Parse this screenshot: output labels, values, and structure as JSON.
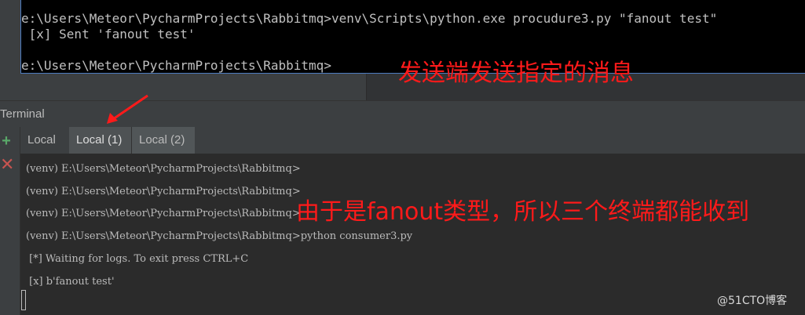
{
  "cmd_window": {
    "lines": [
      "e:\\Users\\Meteor\\PycharmProjects\\Rabbitmq>venv\\Scripts\\python.exe procudure3.py \"fanout test\"",
      " [x] Sent 'fanout test'",
      "",
      "e:\\Users\\Meteor\\PycharmProjects\\Rabbitmq>"
    ]
  },
  "terminal": {
    "title": "Terminal",
    "tabs": [
      {
        "label": "Local"
      },
      {
        "label": "Local (1)"
      },
      {
        "label": "Local (2)"
      }
    ],
    "lines": [
      "(venv) E:\\Users\\Meteor\\PycharmProjects\\Rabbitmq>",
      "(venv) E:\\Users\\Meteor\\PycharmProjects\\Rabbitmq>",
      "(venv) E:\\Users\\Meteor\\PycharmProjects\\Rabbitmq>",
      "(venv) E:\\Users\\Meteor\\PycharmProjects\\Rabbitmq>python consumer3.py",
      " [*] Waiting for logs. To exit press CTRL+C",
      " [x] b'fanout test'"
    ],
    "icons": {
      "add": "plus-icon",
      "close": "close-icon"
    }
  },
  "annotations": {
    "sender_note": "发送端发送指定的消息",
    "fanout_note": "由于是fanout类型，所以三个终端都能收到"
  },
  "watermark": "@51CTO博客",
  "colors": {
    "annotation": "#ff1a1a",
    "add_icon": "#59a869",
    "close_icon": "#c75450"
  }
}
